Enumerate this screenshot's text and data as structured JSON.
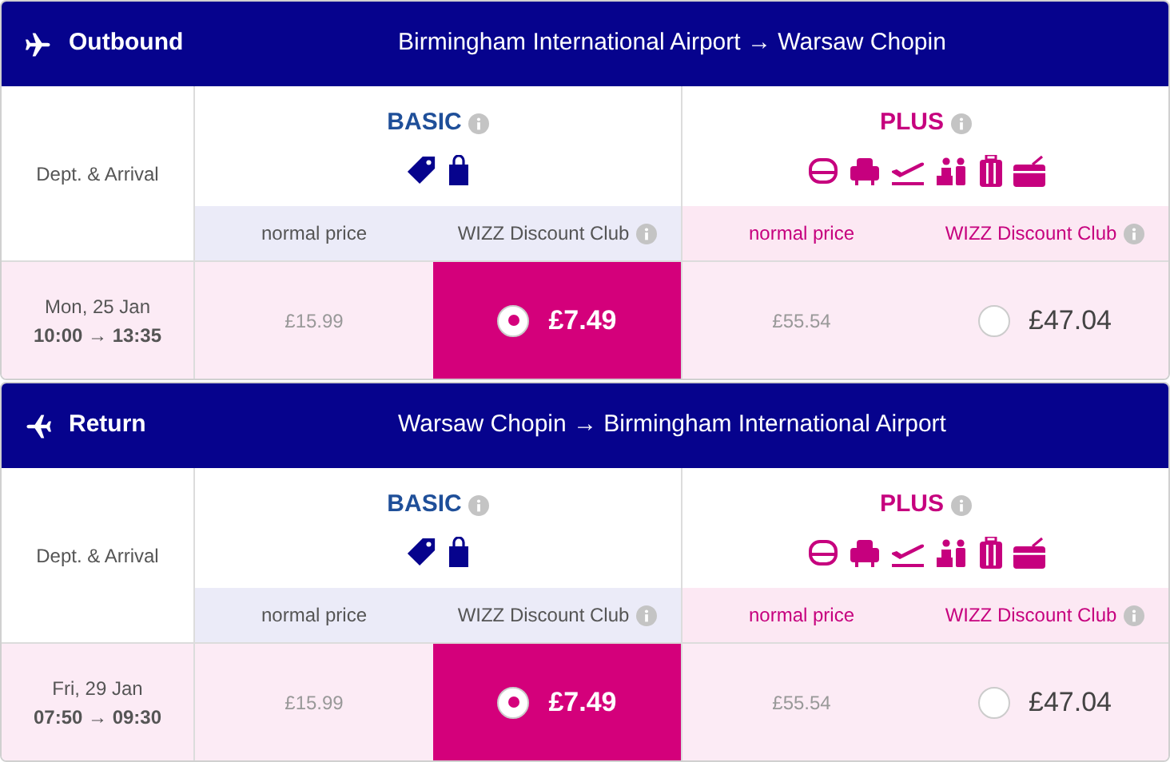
{
  "flights": [
    {
      "kind": "outbound",
      "label": "Outbound",
      "route": "Birmingham International Airport → Warsaw Chopin",
      "column_label": "Dept. & Arrival",
      "date": "Mon, 25 Jan",
      "times": "10:00 → 13:35",
      "fares": [
        {
          "kind": "basic",
          "title": "BASIC",
          "normal_label": "normal price",
          "club_label": "WIZZ Discount Club",
          "normal_price": "£15.99",
          "club_price": "£7.49",
          "selected": true
        },
        {
          "kind": "plus",
          "title": "PLUS",
          "normal_label": "normal price",
          "club_label": "WIZZ Discount Club",
          "normal_price": "£55.54",
          "club_price": "£47.04",
          "selected": false
        }
      ]
    },
    {
      "kind": "return",
      "label": "Return",
      "route": "Warsaw Chopin → Birmingham International Airport",
      "column_label": "Dept. & Arrival",
      "date": "Fri, 29 Jan",
      "times": "07:50 → 09:30",
      "fares": [
        {
          "kind": "basic",
          "title": "BASIC",
          "normal_label": "normal price",
          "club_label": "WIZZ Discount Club",
          "normal_price": "£15.99",
          "club_price": "£7.49",
          "selected": true
        },
        {
          "kind": "plus",
          "title": "PLUS",
          "normal_label": "normal price",
          "club_label": "WIZZ Discount Club",
          "normal_price": "£55.54",
          "club_price": "£47.04",
          "selected": false
        }
      ]
    }
  ]
}
